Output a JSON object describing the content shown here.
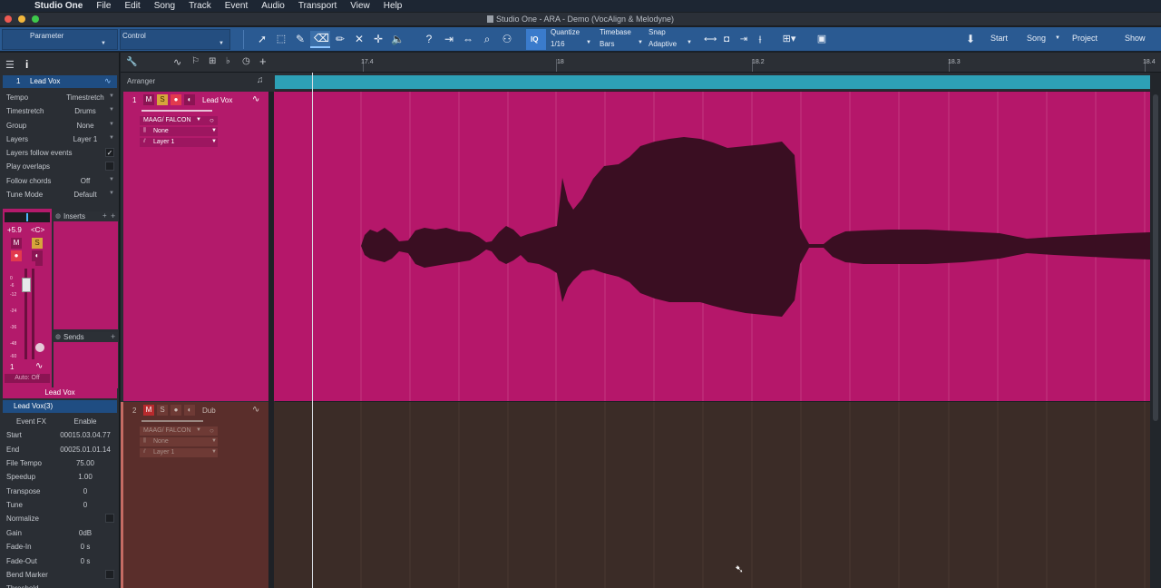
{
  "menubar": {
    "app": "Studio One",
    "items": [
      "File",
      "Edit",
      "Song",
      "Track",
      "Event",
      "Audio",
      "Transport",
      "View",
      "Help"
    ]
  },
  "window": {
    "title": "Studio One - ARA - Demo (VocAlign & Melodyne)"
  },
  "toolbar": {
    "parameter": "Parameter",
    "control": "Control",
    "help": "?",
    "iq": "IQ",
    "quantize_label": "Quantize",
    "quantize_value": "1/16",
    "timebase_label": "Timebase",
    "timebase_value": "Bars",
    "snap_label": "Snap",
    "snap_value": "Adaptive",
    "nav": {
      "start": "Start",
      "song": "Song",
      "project": "Project",
      "show": "Show"
    }
  },
  "inspector": {
    "track_number": "1",
    "track_name": "Lead Vox",
    "rows": [
      {
        "key": "Tempo",
        "value": "Timestretch"
      },
      {
        "key": "Timestretch",
        "value": "Drums"
      },
      {
        "key": "Group",
        "value": "None"
      },
      {
        "key": "Layers",
        "value": "Layer 1"
      },
      {
        "key": "Layers follow events",
        "value": "✓"
      },
      {
        "key": "Play overlaps",
        "value": ""
      },
      {
        "key": "Follow chords",
        "value": "Off"
      },
      {
        "key": "Tune Mode",
        "value": "Default"
      }
    ],
    "channel": {
      "volume": "+5.9",
      "pan": "<C>",
      "mute": "M",
      "solo": "S",
      "number": "1",
      "automation": "Auto: Off",
      "name": "Lead Vox",
      "meter_scale": [
        "0",
        "-6",
        "-12",
        "-24",
        "-36",
        "-48",
        "-60"
      ]
    },
    "inserts_label": "Inserts",
    "sends_label": "Sends",
    "event": {
      "name": "Lead Vox(3)",
      "fx_label": "Event FX",
      "fx_value": "Enable",
      "rows": [
        {
          "key": "Start",
          "value": "00015.03.04.77"
        },
        {
          "key": "End",
          "value": "00025.01.01.14"
        },
        {
          "key": "File Tempo",
          "value": "75.00"
        },
        {
          "key": "Speedup",
          "value": "1.00"
        },
        {
          "key": "Transpose",
          "value": "0"
        },
        {
          "key": "Tune",
          "value": "0"
        },
        {
          "key": "Normalize",
          "value": ""
        },
        {
          "key": "Gain",
          "value": "0dB"
        },
        {
          "key": "Fade-In",
          "value": "0 s"
        },
        {
          "key": "Fade-Out",
          "value": "0 s"
        },
        {
          "key": "Bend Marker",
          "value": ""
        },
        {
          "key": "Threshold",
          "value": ""
        }
      ]
    }
  },
  "ruler": {
    "ticks": [
      {
        "label": "17.4",
        "pos": 0.1
      },
      {
        "label": "18",
        "pos": 0.322
      },
      {
        "label": "18.2",
        "pos": 0.543
      },
      {
        "label": "18.3",
        "pos": 0.765
      },
      {
        "label": "18.4",
        "pos": 0.987
      }
    ]
  },
  "arranger": {
    "label": "Arranger"
  },
  "tracks": [
    {
      "number": "1",
      "mute": "M",
      "solo": "S",
      "name": "Lead Vox",
      "instrument": "MAAG/ FALCON",
      "input": "None",
      "layer": "Layer 1"
    },
    {
      "number": "2",
      "mute": "M",
      "solo": "S",
      "name": "Dub",
      "instrument": "MAAG/ FALCON",
      "input": "None",
      "layer": "Layer 1"
    }
  ],
  "colors": {
    "track1": "#b5176a",
    "track1_header": "#b31a6b",
    "track2": "#3b2c27",
    "arranger": "#2da0b6",
    "toolbar": "#2a5a92",
    "solo": "#d7a53c"
  }
}
